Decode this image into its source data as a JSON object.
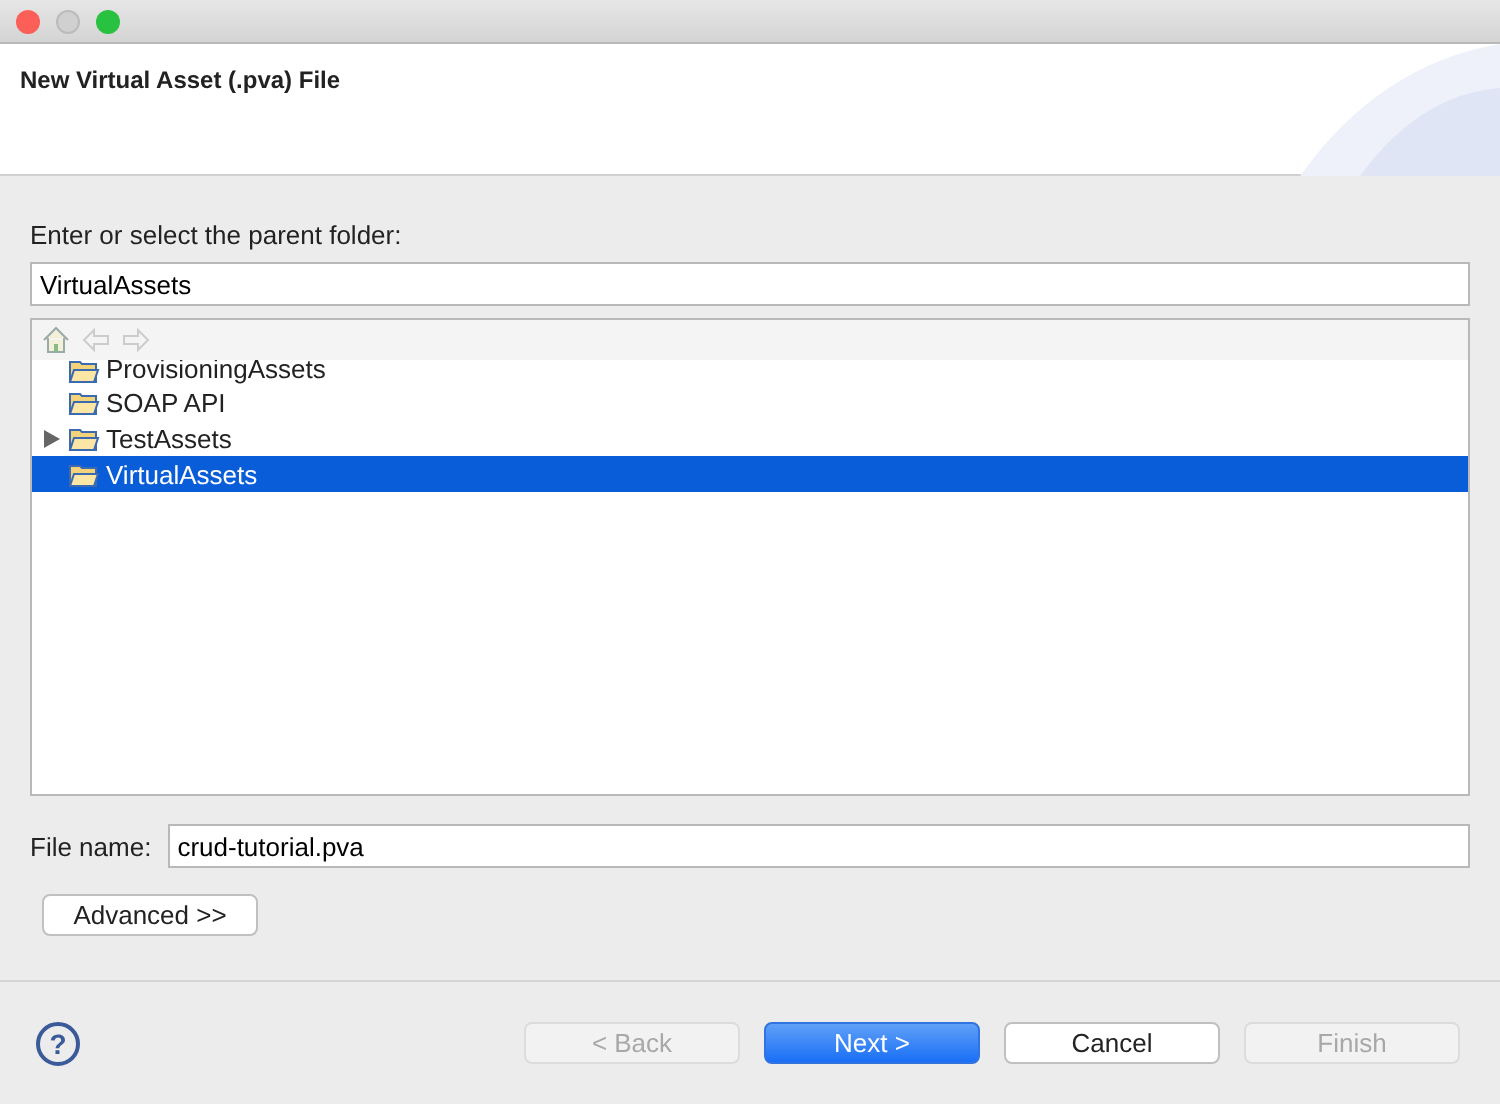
{
  "window": {
    "title": "New Virtual Asset (.pva) File"
  },
  "folder": {
    "label": "Enter or select the parent folder:",
    "value": "VirtualAssets"
  },
  "tree": {
    "items": [
      {
        "label": "ProvisioningAssets",
        "expandable": false,
        "selected": false
      },
      {
        "label": "SOAP API",
        "expandable": false,
        "selected": false
      },
      {
        "label": "TestAssets",
        "expandable": true,
        "selected": false
      },
      {
        "label": "VirtualAssets",
        "expandable": false,
        "selected": true
      }
    ]
  },
  "file_name": {
    "label": "File name:",
    "value": "crud-tutorial.pva"
  },
  "advanced_button": "Advanced >>",
  "help": "?",
  "buttons": [
    {
      "label": "< Back",
      "kind": "normal",
      "disabled": true
    },
    {
      "label": "Next >",
      "kind": "default",
      "disabled": false
    },
    {
      "label": "Cancel",
      "kind": "normal",
      "disabled": false
    },
    {
      "label": "Finish",
      "kind": "normal",
      "disabled": true
    }
  ]
}
